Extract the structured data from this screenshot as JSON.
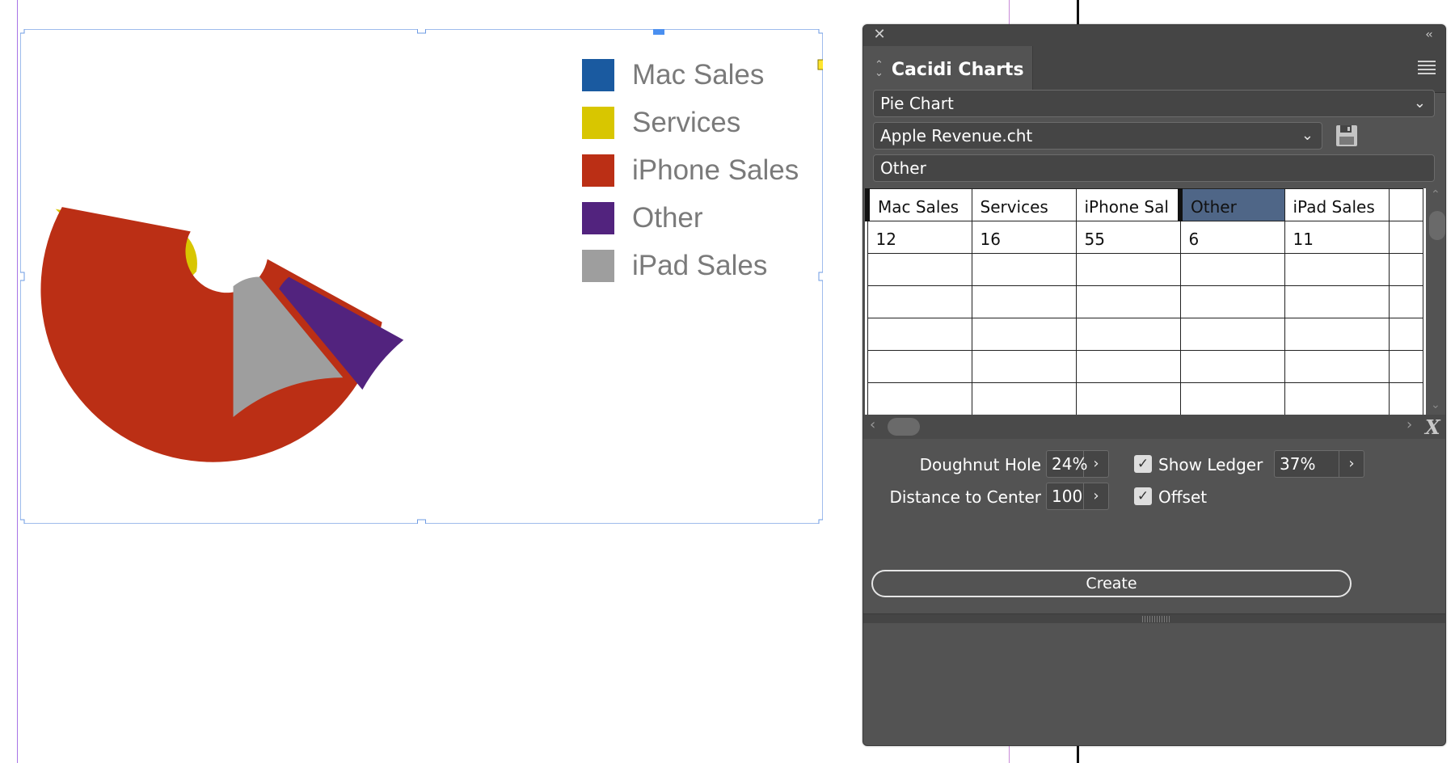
{
  "chart_data": {
    "type": "pie",
    "categories": [
      "Mac Sales",
      "Services",
      "iPhone Sales",
      "Other",
      "iPad Sales"
    ],
    "values": [
      12,
      16,
      55,
      6,
      11
    ],
    "colors": [
      "#1a5aa0",
      "#d8c600",
      "#bb2f15",
      "#52237e",
      "#9e9e9e"
    ],
    "doughnut_hole": 0.24,
    "offset": true,
    "legend_position": "right"
  },
  "panel": {
    "close_icon": "close-icon",
    "collapse_icon": "collapse-double-chevron-icon",
    "tab_title": "Cacidi Charts",
    "menu_icon": "hamburger-menu-icon",
    "chart_type": "Pie Chart",
    "file_name": "Apple Revenue.cht",
    "save_icon": "floppy-disk-icon",
    "selected_cell_value": "Other",
    "grid": {
      "headers": [
        "Mac Sales",
        "Services",
        "iPhone Sal",
        "Other",
        "iPad Sales",
        ""
      ],
      "values": [
        "12",
        "16",
        "55",
        "6",
        "11",
        ""
      ],
      "selected_column": 3
    },
    "doughnut_hole_label": "Doughnut Hole",
    "doughnut_hole_value": "24%",
    "distance_label": "Distance to Center",
    "distance_value": "100",
    "show_ledger_label": "Show Ledger",
    "show_ledger_checked": true,
    "show_ledger_value": "37%",
    "offset_label": "Offset",
    "offset_checked": true,
    "create_label": "Create"
  }
}
